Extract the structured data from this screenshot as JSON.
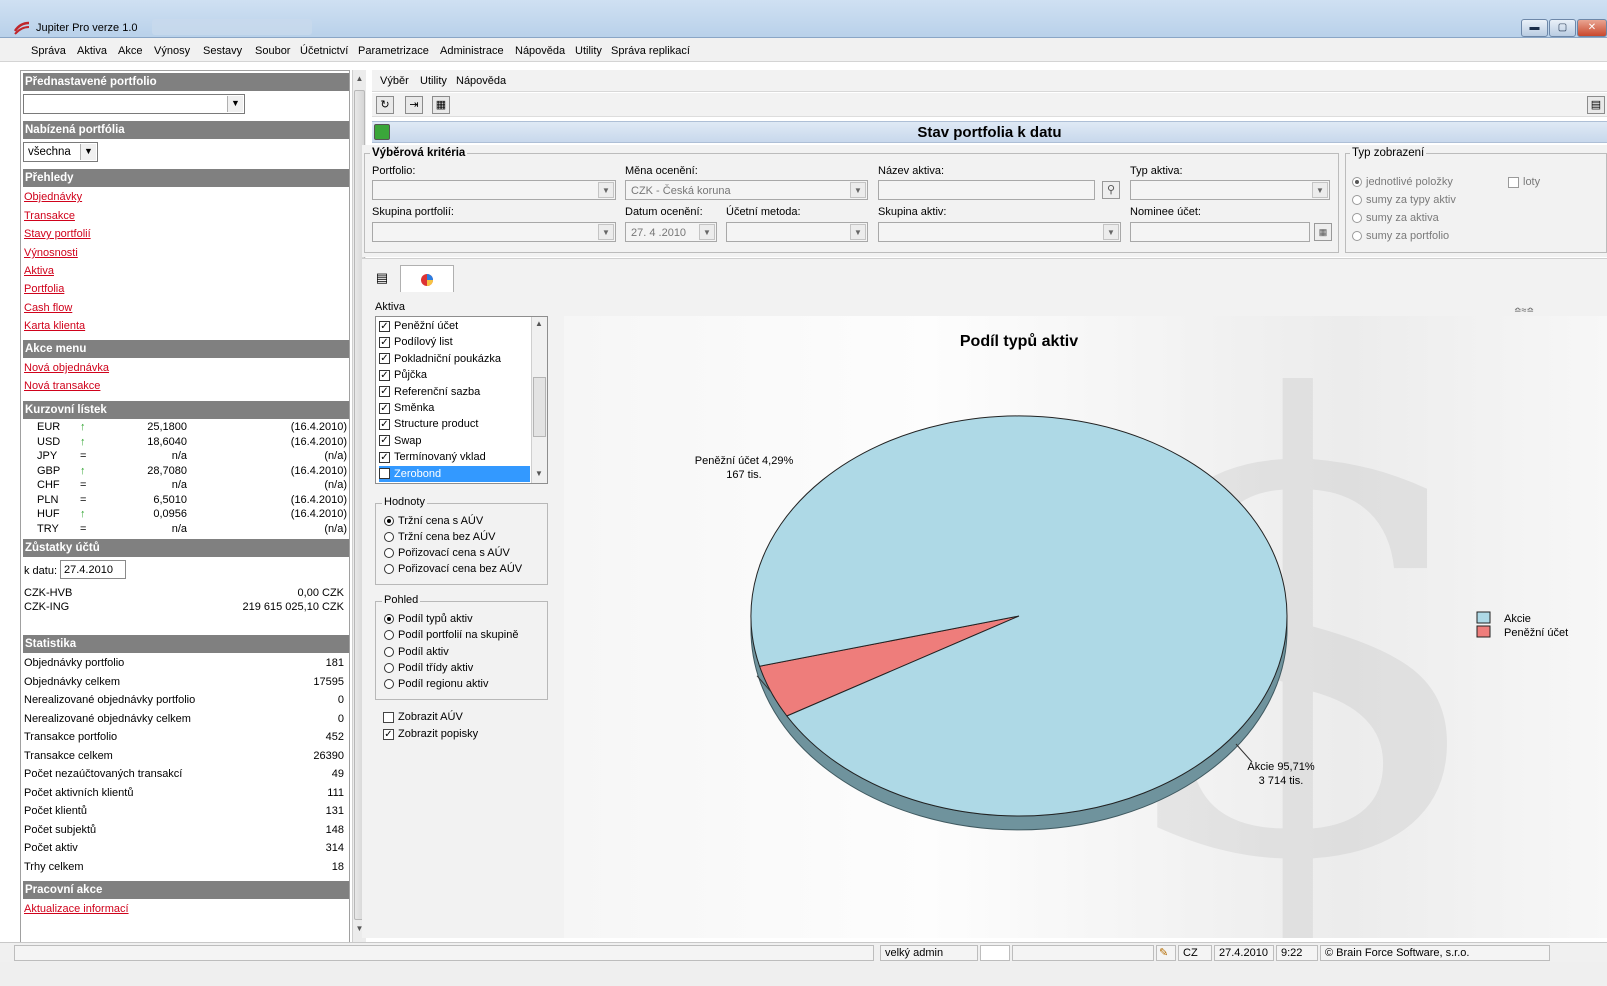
{
  "window": {
    "title": "Jupiter Pro verze 1.0"
  },
  "menubar": {
    "items": [
      "Správa",
      "Aktiva",
      "Akce",
      "Výnosy",
      "Sestavy",
      "Soubor",
      "Účetnictví",
      "Parametrizace",
      "Administrace",
      "Nápověda",
      "Utility",
      "Správa replikací"
    ]
  },
  "left": {
    "preset_header": "Přednastavené portfolio",
    "preset_value": "",
    "offered_header": "Nabízená portfólia",
    "offered_value": "všechna",
    "overview_header": "Přehledy",
    "overview_links": [
      "Objednávky",
      "Transakce",
      "Stavy portfolií",
      "Výnosnosti",
      "Aktiva",
      "Portfolia",
      "Cash flow",
      "Karta klienta"
    ],
    "actions_header": "Akce menu",
    "actions_links": [
      "Nová objednávka",
      "Nová transakce"
    ],
    "fx_header": "Kurzovní lístek",
    "fx": [
      {
        "cur": "EUR",
        "trend": "up",
        "rate": "25,1800",
        "date": "(16.4.2010)"
      },
      {
        "cur": "USD",
        "trend": "up",
        "rate": "18,6040",
        "date": "(16.4.2010)"
      },
      {
        "cur": "JPY",
        "trend": "eq",
        "rate": "n/a",
        "date": "(n/a)"
      },
      {
        "cur": "GBP",
        "trend": "up",
        "rate": "28,7080",
        "date": "(16.4.2010)"
      },
      {
        "cur": "CHF",
        "trend": "eq",
        "rate": "n/a",
        "date": "(n/a)"
      },
      {
        "cur": "PLN",
        "trend": "eq",
        "rate": "6,5010",
        "date": "(16.4.2010)"
      },
      {
        "cur": "HUF",
        "trend": "up",
        "rate": "0,0956",
        "date": "(16.4.2010)"
      },
      {
        "cur": "TRY",
        "trend": "eq",
        "rate": "n/a",
        "date": "(n/a)"
      }
    ],
    "trend_up_symbol": "↑",
    "trend_eq_symbol": "=",
    "balances_header": "Zůstatky účtů",
    "k_datu_label": "k datu:",
    "k_datu_value": "27.4.2010",
    "accounts": [
      {
        "name": "CZK-HVB",
        "value": "0,00 CZK"
      },
      {
        "name": "CZK-ING",
        "value": "219 615 025,10 CZK"
      }
    ],
    "stats_header": "Statistika",
    "stats": [
      {
        "label": "Objednávky portfolio",
        "value": "181"
      },
      {
        "label": "Objednávky celkem",
        "value": "17595"
      },
      {
        "label": "Nerealizované objednávky portfolio",
        "value": "0"
      },
      {
        "label": "Nerealizované objednávky celkem",
        "value": "0"
      },
      {
        "label": "Transakce portfolio",
        "value": "452"
      },
      {
        "label": "Transakce celkem",
        "value": "26390"
      },
      {
        "label": "Počet nezaúčtovaných transakcí",
        "value": "49"
      },
      {
        "label": "Počet aktivních klientů",
        "value": "111"
      },
      {
        "label": "Počet klientů",
        "value": "131"
      },
      {
        "label": "Počet subjektů",
        "value": "148"
      },
      {
        "label": "Počet aktiv",
        "value": "314"
      },
      {
        "label": "Trhy celkem",
        "value": "18"
      }
    ],
    "work_header": "Pracovní akce",
    "work_links": [
      "Aktualizace informací"
    ]
  },
  "right": {
    "menu": [
      "Výběr",
      "Utility",
      "Nápověda"
    ],
    "page_title": "Stav portfolia k datu",
    "criteria": {
      "legend": "Výběrová kritéria",
      "portfolio_label": "Portfolio:",
      "portfolio_value": "",
      "currency_label": "Měna ocenění:",
      "currency_value": "CZK - Česká koruna",
      "asset_name_label": "Název aktiva:",
      "asset_type_label": "Typ aktiva:",
      "group_label": "Skupina portfolií:",
      "date_label": "Datum ocenění:",
      "date_value": "27. 4 .2010",
      "method_label": "Účetní metoda:",
      "asset_group_label": "Skupina aktiv:",
      "nominee_label": "Nominee účet:"
    },
    "display": {
      "legend": "Typ zobrazení",
      "options": [
        "jednotlivé položky",
        "sumy za typy aktiv",
        "sumy za aktiva",
        "sumy za portfolio"
      ],
      "selected": 0,
      "loty_label": "loty"
    },
    "aktiva_label": "Aktiva",
    "assets": [
      {
        "name": "Peněžní účet",
        "checked": true
      },
      {
        "name": "Podílový list",
        "checked": true
      },
      {
        "name": "Pokladniční poukázka",
        "checked": true
      },
      {
        "name": "Půjčka",
        "checked": true
      },
      {
        "name": "Referenční sazba",
        "checked": true
      },
      {
        "name": "Směnka",
        "checked": true
      },
      {
        "name": "Structure product",
        "checked": true
      },
      {
        "name": "Swap",
        "checked": true
      },
      {
        "name": "Termínovaný vklad",
        "checked": true
      },
      {
        "name": "Zerobond",
        "checked": true,
        "selected": true
      }
    ],
    "values_group": {
      "legend": "Hodnoty",
      "options": [
        "Tržní cena s AÚV",
        "Tržní cena bez AÚV",
        "Pořizovací cena s AÚV",
        "Pořizovací cena bez AÚV"
      ],
      "selected": 0
    },
    "view_group": {
      "legend": "Pohled",
      "options": [
        "Podíl typů aktiv",
        "Podíl portfolií na skupině",
        "Podíl aktiv",
        "Podíl třídy aktiv",
        "Podíl regionu aktiv"
      ],
      "selected": 0
    },
    "show_auv_label": "Zobrazit AÚV",
    "show_auv": false,
    "show_labels_label": "Zobrazit popisky",
    "show_labels": true,
    "chart_colors": {
      "akcie": "#aed9e6",
      "penezni": "#ee7d7b",
      "akcie_side": "#6f939d"
    }
  },
  "chart_data": {
    "type": "pie",
    "title": "Podíl typů aktiv",
    "slices": [
      {
        "name": "Akcie",
        "percent": 95.71,
        "label": "Akcie 95,71%",
        "sublabel": "3 714 tis."
      },
      {
        "name": "Peněžní účet",
        "percent": 4.29,
        "label": "Peněžní účet 4,29%",
        "sublabel": "167 tis."
      }
    ],
    "legend": [
      "Akcie",
      "Peněžní účet"
    ],
    "legend_position": "right"
  },
  "status": {
    "user": "velký admin",
    "lang": "CZ",
    "date": "27.4.2010",
    "time": "9:22",
    "copyright": "© Brain Force Software, s.r.o."
  }
}
